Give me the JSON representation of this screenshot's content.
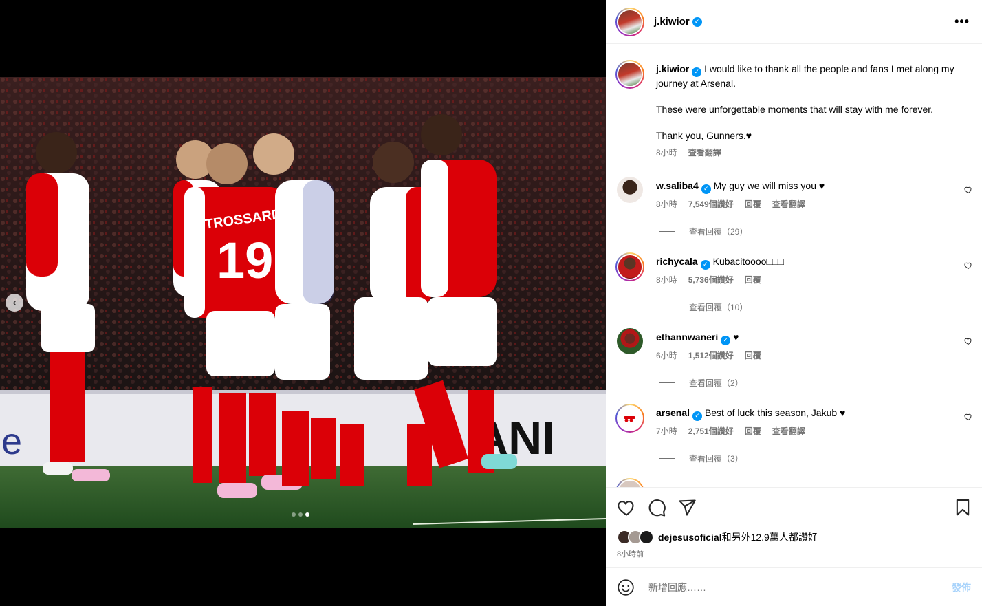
{
  "post": {
    "username": "j.kiwior",
    "verified_icon": "✓",
    "more_icon": "•••"
  },
  "colors": {
    "accent": "#0095f6",
    "muted": "#737373",
    "arsenal_red": "#db0007",
    "pitch_green": "#2c5a2a"
  },
  "media": {
    "prev_icon": "chevron-left-icon",
    "prev_glyph": "‹",
    "dots_total": 3,
    "dot_active_index": 3,
    "jersey_name": "TROSSARD",
    "jersey_number": "19",
    "board_text": "e",
    "board_text_right": "ANI"
  },
  "caption": {
    "username": "j.kiwior",
    "line1": "I would like to thank all the people and fans I met along my journey at Arsenal.",
    "line2": "These were unforgettable moments that will stay with me forever.",
    "line3": "Thank you, Gunners.♥",
    "time": "8小時",
    "translate": "查看翻譯"
  },
  "comments": [
    {
      "username": "w.saliba4",
      "text": "My guy we will miss you ♥",
      "time": "8小時",
      "likes": "7,549個讚好",
      "reply": "回覆",
      "translate": "查看翻譯",
      "view_replies": "查看回覆（29）"
    },
    {
      "username": "richycala",
      "text": "Kubacitoooo□□□",
      "time": "8小時",
      "likes": "5,736個讚好",
      "reply": "回覆",
      "view_replies": "查看回覆（10）"
    },
    {
      "username": "ethannwaneri",
      "text": "♥",
      "time": "6小時",
      "likes": "1,512個讚好",
      "reply": "回覆",
      "view_replies": "查看回覆（2）"
    },
    {
      "username": "arsenal",
      "text": "Best of luck this season, Jakub ♥",
      "time": "7小時",
      "likes": "2,751個讚好",
      "reply": "回覆",
      "translate": "查看翻譯",
      "view_replies": "查看回覆（3）"
    }
  ],
  "actions": {
    "like_icon": "heart-icon",
    "comment_icon": "comment-bubble-icon",
    "share_icon": "paper-plane-icon",
    "save_icon": "bookmark-icon"
  },
  "likes": {
    "user": "dejesusoficial",
    "rest": "和另外12.9萬人都讚好"
  },
  "post_time": "8小時前",
  "composer": {
    "placeholder": "新增回應……",
    "post_label": "發佈",
    "emoji_icon": "smiley-face-icon"
  }
}
